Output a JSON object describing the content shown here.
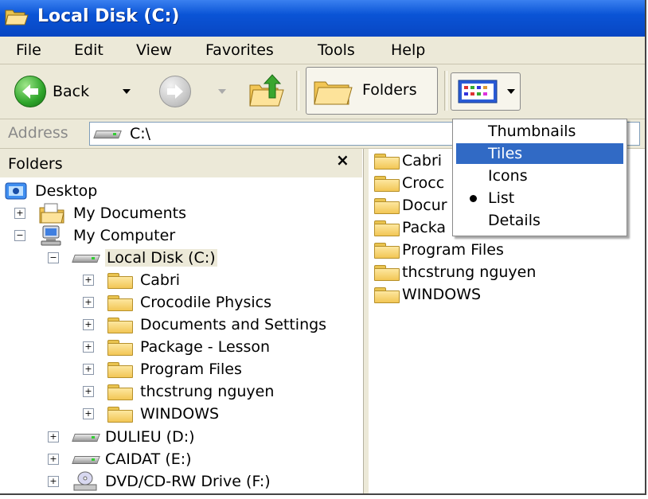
{
  "window": {
    "title": "Local Disk (C:)"
  },
  "menu": [
    "File",
    "Edit",
    "View",
    "Favorites",
    "Tools",
    "Help"
  ],
  "toolbar": {
    "back_label": "Back",
    "folders_label": "Folders"
  },
  "address": {
    "label": "Address",
    "value": "C:\\"
  },
  "folders_pane": {
    "title": "Folders",
    "close_glyph": "×",
    "tree": [
      {
        "label": "Desktop",
        "icon": "desktop-icon"
      },
      {
        "label": "My Documents",
        "icon": "my-documents-icon",
        "expander": "+"
      },
      {
        "label": "My Computer",
        "icon": "my-computer-icon",
        "expander": "−"
      },
      {
        "label": "Local Disk (C:)",
        "icon": "drive-icon",
        "expander": "−",
        "selected": true
      },
      {
        "label": "Cabri",
        "icon": "folder-icon",
        "expander": "+"
      },
      {
        "label": "Crocodile Physics",
        "icon": "folder-icon",
        "expander": "+"
      },
      {
        "label": "Documents and Settings",
        "icon": "folder-icon",
        "expander": "+"
      },
      {
        "label": "Package - Lesson",
        "icon": "folder-icon",
        "expander": "+"
      },
      {
        "label": "Program Files",
        "icon": "folder-icon",
        "expander": "+"
      },
      {
        "label": "thcstrung nguyen",
        "icon": "folder-icon",
        "expander": "+"
      },
      {
        "label": "WINDOWS",
        "icon": "folder-icon",
        "expander": "+"
      },
      {
        "label": "DULIEU (D:)",
        "icon": "drive-icon",
        "expander": "+"
      },
      {
        "label": "CAIDAT (E:)",
        "icon": "drive-icon",
        "expander": "+"
      },
      {
        "label": "DVD/CD-RW Drive (F:)",
        "icon": "cd-drive-icon",
        "expander": "+"
      }
    ]
  },
  "content_list": [
    "Cabri",
    "Crocc",
    "Docur",
    "Packa",
    "Program Files",
    "thcstrung nguyen",
    "WINDOWS"
  ],
  "views_menu": {
    "items": [
      "Thumbnails",
      "Tiles",
      "Icons",
      "List",
      "Details"
    ],
    "highlighted": "Tiles",
    "checked": "List"
  },
  "colors": {
    "titlebar": "#0a54d6",
    "highlight": "#316ac5",
    "chrome": "#ece9d8"
  }
}
